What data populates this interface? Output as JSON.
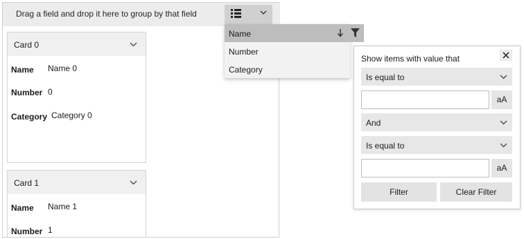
{
  "group_panel": {
    "text": "Drag a field and drop it here to group by that field"
  },
  "cards": [
    {
      "title": "Card 0",
      "fields": [
        {
          "name": "Name",
          "value": "Name 0"
        },
        {
          "name": "Number",
          "value": "0"
        },
        {
          "name": "Category",
          "value": "Category 0"
        }
      ]
    },
    {
      "title": "Card 1",
      "fields": [
        {
          "name": "Name",
          "value": "Name 1"
        },
        {
          "name": "Number",
          "value": "1"
        }
      ]
    }
  ],
  "sort_menu": {
    "items": [
      "Name",
      "Number",
      "Category"
    ],
    "selected": "Name"
  },
  "filter": {
    "title": "Show items with value that",
    "operator1": "Is equal to",
    "logical": "And",
    "operator2": "Is equal to",
    "value1": "",
    "value2": "",
    "case_label": "aA",
    "filter_button": "Filter",
    "clear_button": "Clear Filter"
  },
  "icons": [
    "list-icon",
    "chevron-down-icon",
    "arrow-down-icon",
    "funnel-icon",
    "close-icon"
  ]
}
